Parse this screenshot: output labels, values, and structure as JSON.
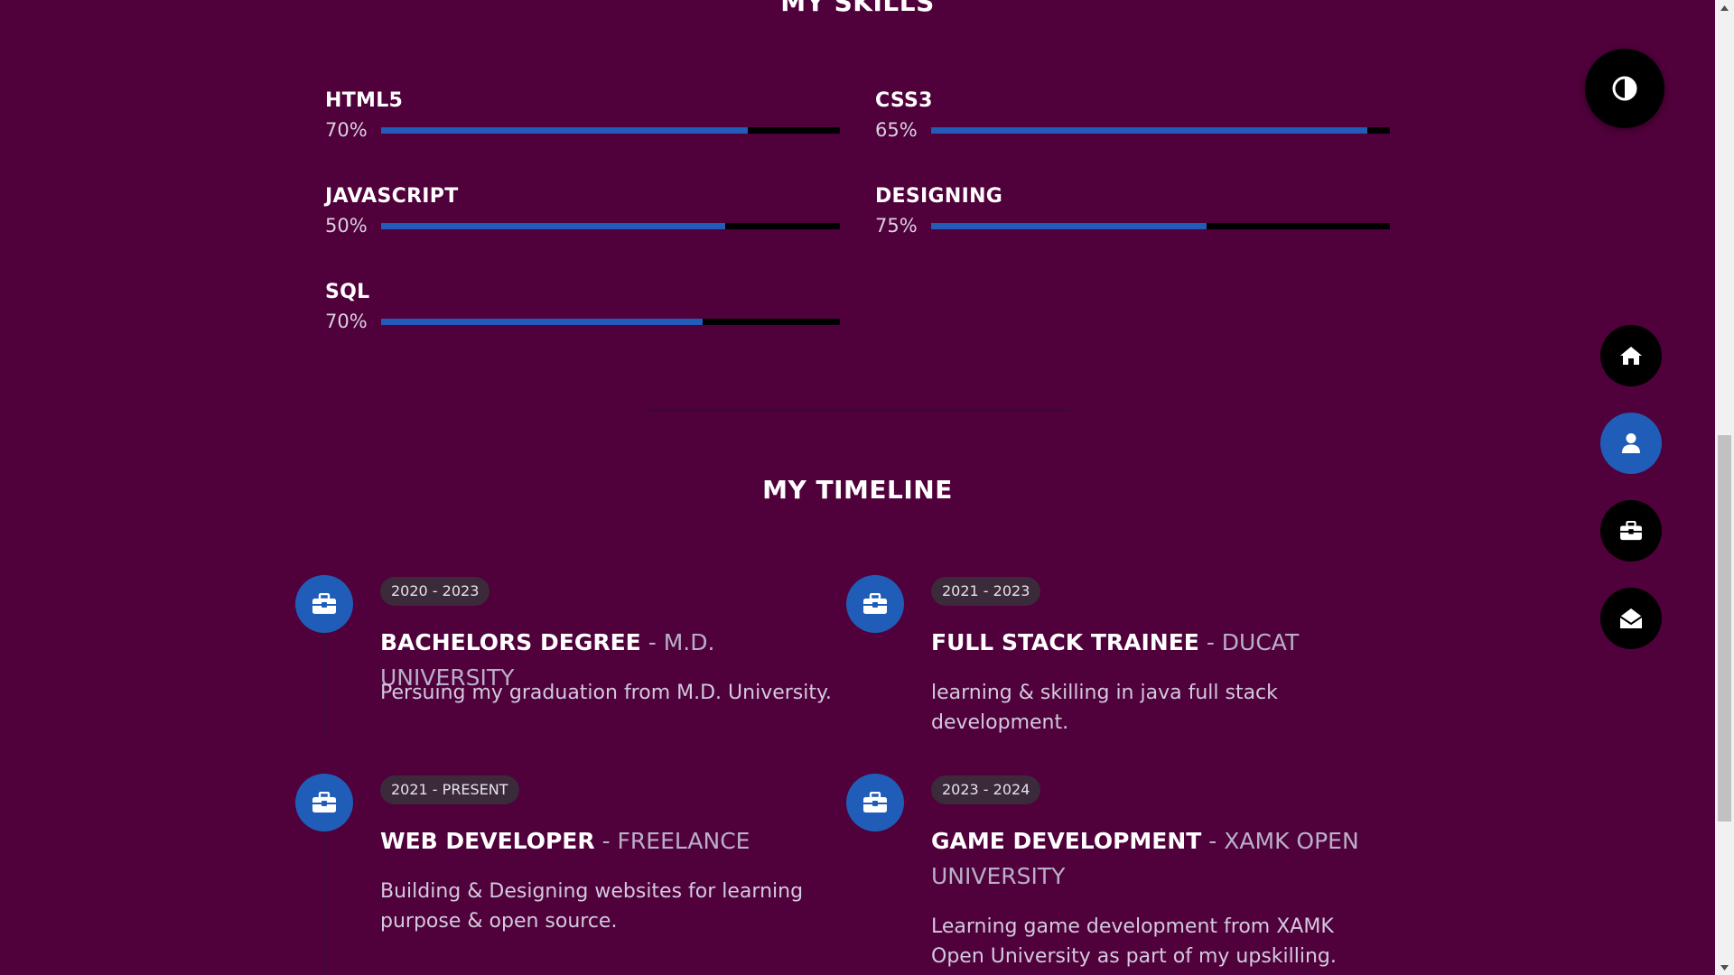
{
  "skills": {
    "title": "MY SKILLS",
    "items": [
      {
        "name": "HTML5",
        "percent_label": "70%",
        "bar_fill": 0.8
      },
      {
        "name": "CSS3",
        "percent_label": "65%",
        "bar_fill": 0.95
      },
      {
        "name": "JAVASCRIPT",
        "percent_label": "50%",
        "bar_fill": 0.75
      },
      {
        "name": "DESIGNING",
        "percent_label": "75%",
        "bar_fill": 0.6
      },
      {
        "name": "SQL",
        "percent_label": "70%",
        "bar_fill": 0.7
      }
    ]
  },
  "timeline": {
    "title": "MY TIMELINE",
    "items": [
      {
        "dates": "2020 - 2023",
        "role": "BACHELORS DEGREE",
        "separator": " - ",
        "org": "M.D. UNIVERSITY",
        "description": "Persuing my graduation from M.D. University."
      },
      {
        "dates": "2021 - 2023",
        "role": "FULL STACK TRAINEE",
        "separator": " - ",
        "org": "DUCAT",
        "description": "learning & skilling in java full stack development."
      },
      {
        "dates": "2021 - PRESENT",
        "role": "WEB DEVELOPER",
        "separator": " - ",
        "org": "FREELANCE",
        "description": "Building & Designing websites for learning purpose & open source."
      },
      {
        "dates": "2023 - 2024",
        "role": "GAME DEVELOPMENT",
        "separator": " - ",
        "org": "XAMK OPEN UNIVERSITY",
        "description": "Learning game development from XAMK Open University as part of my upskilling."
      }
    ]
  },
  "controls": {
    "theme_toggle_icon": "contrast-icon",
    "nav": [
      {
        "icon": "home-icon",
        "active": false
      },
      {
        "icon": "user-icon",
        "active": true
      },
      {
        "icon": "briefcase-icon",
        "active": false
      },
      {
        "icon": "envelope-open-icon",
        "active": false
      }
    ]
  },
  "colors": {
    "background": "#50003a",
    "accent": "#1f5db8",
    "bar_track": "#000000",
    "badge": "#3a2a3a"
  }
}
